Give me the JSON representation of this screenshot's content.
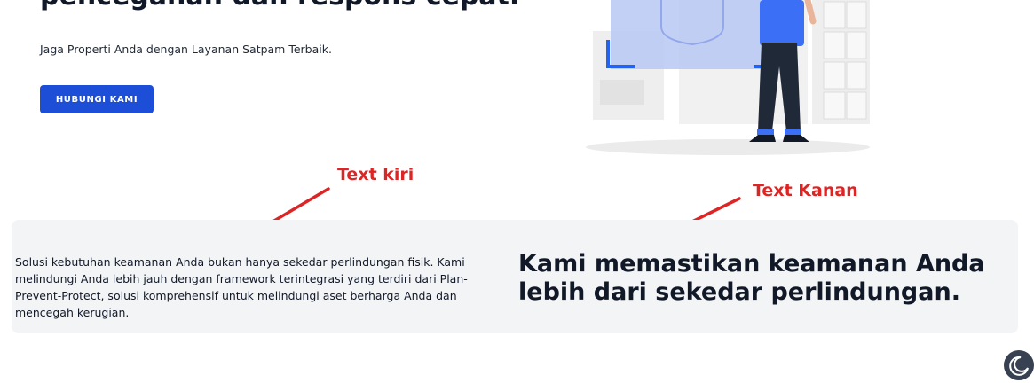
{
  "hero": {
    "title": "pencegahan dan respons cepat.",
    "subtitle": "Jaga Properti Anda dengan Layanan Satpam Terbaik.",
    "cta_label": "HUBUNGI KAMI"
  },
  "annotations": {
    "left": "Text kiri",
    "right": "Text Kanan",
    "color": "#dc2626"
  },
  "panel": {
    "left_text": "Solusi kebutuhan keamanan Anda bukan hanya sekedar perlindungan fisik. Kami melindungi Anda lebih jauh dengan framework terintegrasi yang terdiri dari Plan-Prevent-Protect, solusi komprehensif untuk melindungi aset berharga Anda dan mencegah kerugian.",
    "right_text": "Kami memastikan keamanan Anda lebih dari sekedar perlindungan."
  },
  "theme_toggle": {
    "icon": "moon-icon"
  },
  "colors": {
    "accent": "#1d4ed8",
    "panel_bg": "#f3f4f6"
  }
}
